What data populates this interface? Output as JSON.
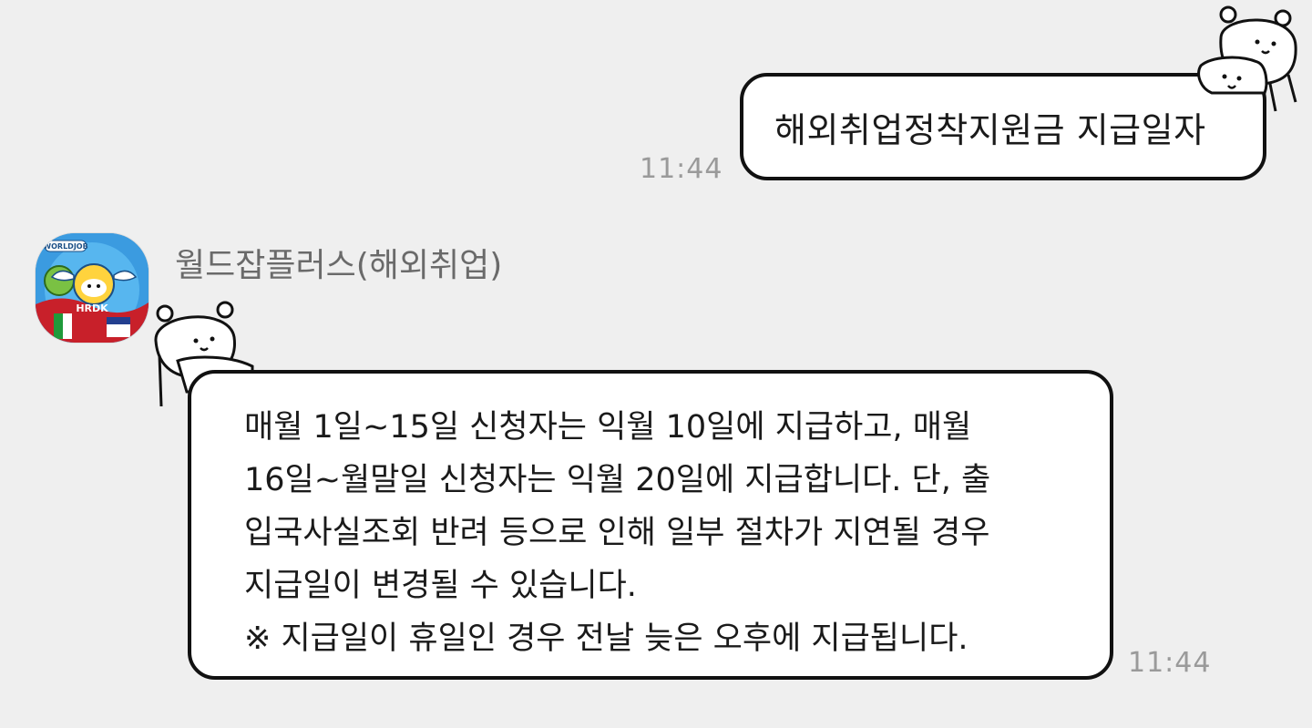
{
  "outgoing": {
    "text": "해외취업정착지원금 지급일자",
    "time": "11:44"
  },
  "incoming": {
    "sender": "월드잡플러스(해외취업)",
    "avatar_badge": "WORLDJOB",
    "avatar_mark": "HRDK",
    "lines": [
      "매월 1일~15일 신청자는 익월 10일에 지급하고, 매월",
      "16일~월말일 신청자는 익월 20일에 지급합니다. 단, 출",
      "입국사실조회 반려 등으로 인해 일부 절차가 지연될 경우",
      "지급일이 변경될 수 있습니다.",
      "※ 지급일이 휴일인 경우 전날 늦은 오후에 지급됩니다."
    ],
    "time": "11:44"
  },
  "colors": {
    "background": "#efefef",
    "bubble": "#ffffff",
    "outline": "#111111",
    "timestamp": "#9a9a9a",
    "sender": "#6a6a6a"
  },
  "icons": {
    "sticker": "bear-sticker-icon",
    "avatar": "worldjob-mascot-avatar"
  }
}
